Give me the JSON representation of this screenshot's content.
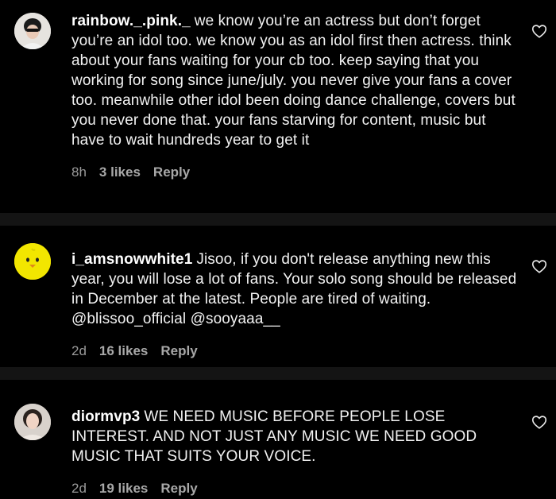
{
  "comments": [
    {
      "username": "rainbow._.pink._",
      "text": "we know you’re an actress but don’t forget you’re an idol too. we know you as an idol first then actress. think about your fans waiting for your cb too. keep saying that you working for song since june/july. you never give your fans a cover too. meanwhile other idol been doing dance challenge, covers but you never done that. your fans starving for content, music but have to wait hundreds year to get it",
      "time": "8h",
      "likes": "3 likes",
      "reply": "Reply"
    },
    {
      "username": "i_amsnowwhite1",
      "text": "Jisoo, if you don't release anything new this year, you will lose a lot of fans. Your solo song should be released in December at the latest. People are tired of waiting. @blissoo_official @sooyaaa__",
      "time": "2d",
      "likes": "16 likes",
      "reply": "Reply"
    },
    {
      "username": "diormvp3",
      "text": "WE NEED MUSIC BEFORE PEOPLE LOSE INTEREST. AND NOT JUST ANY MUSIC WE NEED GOOD MUSIC THAT SUITS YOUR VOICE.",
      "time": "2d",
      "likes": "19 likes",
      "reply": "Reply"
    }
  ],
  "icons": {
    "like": "heart-outline-icon"
  }
}
